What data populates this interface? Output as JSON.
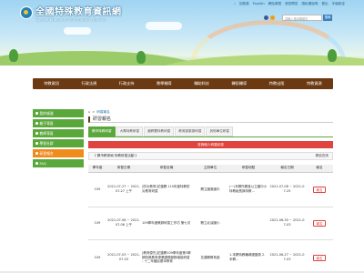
{
  "header": {
    "site_title_zh": "全國特殊教育資訊網",
    "site_title_en": "Special Education Information Network",
    "top_links": [
      "::",
      "回首頁",
      "English",
      "網站導覽",
      "常見問答",
      "隱私權說明",
      "登出",
      "字級設定"
    ],
    "search": {
      "placeholder": "請輸入搜尋關鍵字",
      "button": "搜尋"
    }
  },
  "nav": {
    "items": [
      "特教資訊",
      "行政法規",
      "行政支持",
      "教學輔導",
      "輔助科技",
      "轉銜輔導",
      "特教出版",
      "特教資源"
    ]
  },
  "sidebar": {
    "items": [
      {
        "label": "我的帳號",
        "active": false
      },
      {
        "label": "親子專區",
        "active": false
      },
      {
        "label": "教師專區",
        "active": false
      },
      {
        "label": "學習社群",
        "active": false
      },
      {
        "label": "研習報名",
        "active": true
      },
      {
        "label": "FAQ",
        "active": false
      }
    ]
  },
  "breadcrumb": {
    "home_icon": "home-icon",
    "separator": ">",
    "current": "研習報名"
  },
  "page_title": "研習報名",
  "tabs": [
    {
      "label": "縣市特教研習",
      "active": true
    },
    {
      "label": "大專特教研習",
      "active": false
    },
    {
      "label": "國教署特教研習",
      "active": false
    },
    {
      "label": "教育部委辦研習",
      "active": false
    },
    {
      "label": "其他單位研習",
      "active": false
    }
  ],
  "action_button": "查詢個人研習紀錄",
  "filter": {
    "label": "《 縣市教育局 特教研習活動 》",
    "expand": "開啟查詢"
  },
  "table": {
    "headers": [
      "學年度",
      "研習日期",
      "研習名稱",
      "主辦單位",
      "研習地點",
      "報名日期",
      "報名"
    ],
    "rows": [
      {
        "year": "109",
        "date": "2021-07-27 ~ 2021-07-27 上午",
        "name": "(防災教育)花蓮縣 110年度特教防災教育研習",
        "organizer": "縣立國風國中",
        "location": "(一)本縣所屬各公立國中小特教組長與特教...",
        "signup": "2021-07-08 ~ 2021-07-25",
        "action": "報名"
      },
      {
        "year": "109",
        "date": "2021-07-06 ~ 2021-07-06 上午",
        "name": "109學年度教師研習工作坊 第七次",
        "organizer": "縣立北濱國小",
        "location": "",
        "signup": "2021-06-30 ~ 2021-07-03",
        "action": "報名"
      },
      {
        "year": "109",
        "date": "2021-07-03 ~ 2021-07-03",
        "name": "[教育優先]花蓮縣109學年度第3學期特殊教育專業團隊服務增能研習 - 十二年國民基本教育",
        "organizer": "花蓮縣教育處",
        "location": "1.本縣特教輔導團團員 2.本縣...",
        "signup": "2021-06-27 ~ 2021-07-03",
        "action": "報名"
      }
    ]
  },
  "colors": {
    "nav_bg": "#6b3a12",
    "sidebar_green": "#5aa83b",
    "sidebar_active": "#f08c1d",
    "action_red": "#e0443e"
  }
}
